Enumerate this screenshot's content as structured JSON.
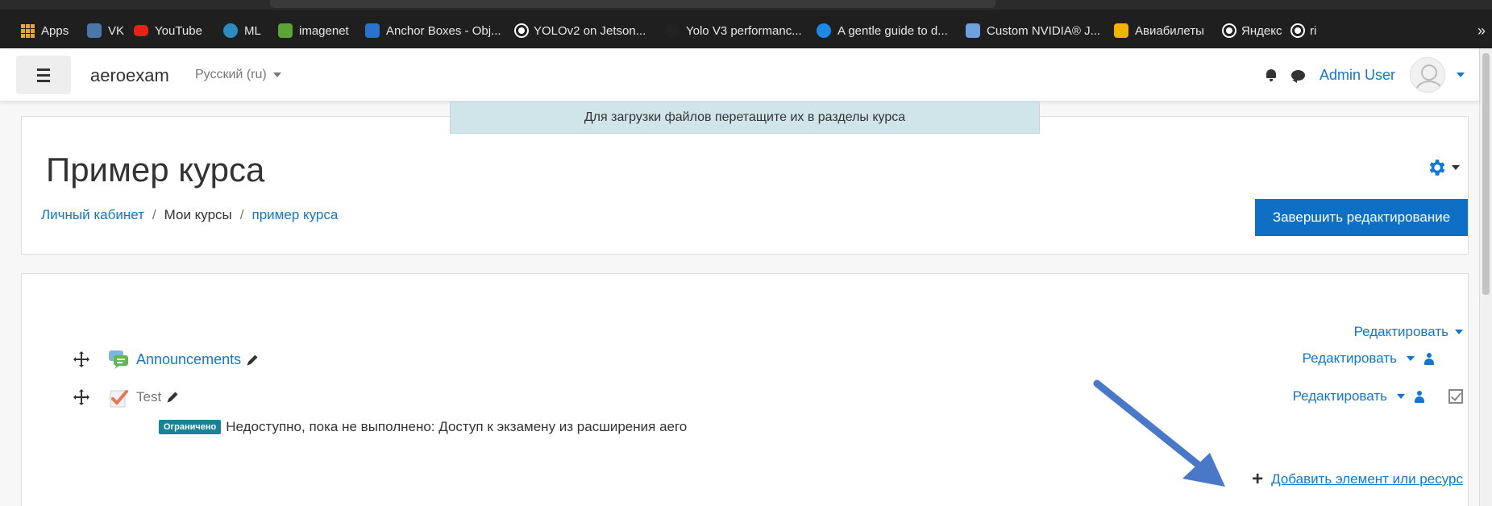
{
  "bookmarks": [
    {
      "label": "Apps",
      "icon": "apps-grid-icon",
      "color": "#e8a33a"
    },
    {
      "label": "VK",
      "icon": "vk-icon",
      "color": "#4a76a8"
    },
    {
      "label": "YouTube",
      "icon": "youtube-icon",
      "color": "#e62117"
    },
    {
      "label": "ML",
      "icon": "wordpress-icon",
      "color": "#2e8bc0"
    },
    {
      "label": "imagenet",
      "icon": "imagenet-icon",
      "color": "#5aa43a"
    },
    {
      "label": "Anchor Boxes - Obj...",
      "icon": "coursera-icon",
      "color": "#2a73cc"
    },
    {
      "label": "YOLOv2 on Jetson...",
      "icon": "globe-icon",
      "color": "#ffffff"
    },
    {
      "label": "Yolo V3 performanc...",
      "icon": "github-icon",
      "color": "#222222"
    },
    {
      "label": "A gentle guide to d...",
      "icon": "p-icon",
      "color": "#1e88e5"
    },
    {
      "label": "Custom NVIDIA® J...",
      "icon": "nvidia-icon",
      "color": "#6ea0e0"
    },
    {
      "label": "Авиабилеты",
      "icon": "plane-icon",
      "color": "#f0b400"
    },
    {
      "label": "Яндекс",
      "icon": "globe-icon",
      "color": "#ffffff"
    },
    {
      "label": "ri",
      "icon": "globe-icon",
      "color": "#ffffff"
    }
  ],
  "bookmarks_more": "»",
  "navbar": {
    "brand": "aeroexam",
    "language": "Русский (ru)",
    "user_name": "Admin User"
  },
  "drop_hint": "Для загрузки файлов перетащите их в разделы курса",
  "header": {
    "title": "Пример курса",
    "breadcrumb": [
      "Личный кабинет",
      "Мои курсы",
      "пример курса"
    ],
    "breadcrumb_separator": "/",
    "finish_button": "Завершить редактирование"
  },
  "section": {
    "edit_label": "Редактировать",
    "activities": [
      {
        "name": "Announcements",
        "icon": "forum-icon",
        "edit_label": "Редактировать"
      },
      {
        "name": "Test",
        "icon": "quiz-icon",
        "edit_label": "Редактировать"
      }
    ],
    "restriction_badge": "Ограничено",
    "restriction_text": "Недоступно, пока не выполнено: Доступ к экзамену из расширения аего",
    "add_resource": "Добавить элемент или ресурс"
  },
  "colors": {
    "link": "#1177d1",
    "primary_button": "#0f6fc5",
    "badge": "#1a8295",
    "annotation_arrow": "#4a78c8"
  }
}
